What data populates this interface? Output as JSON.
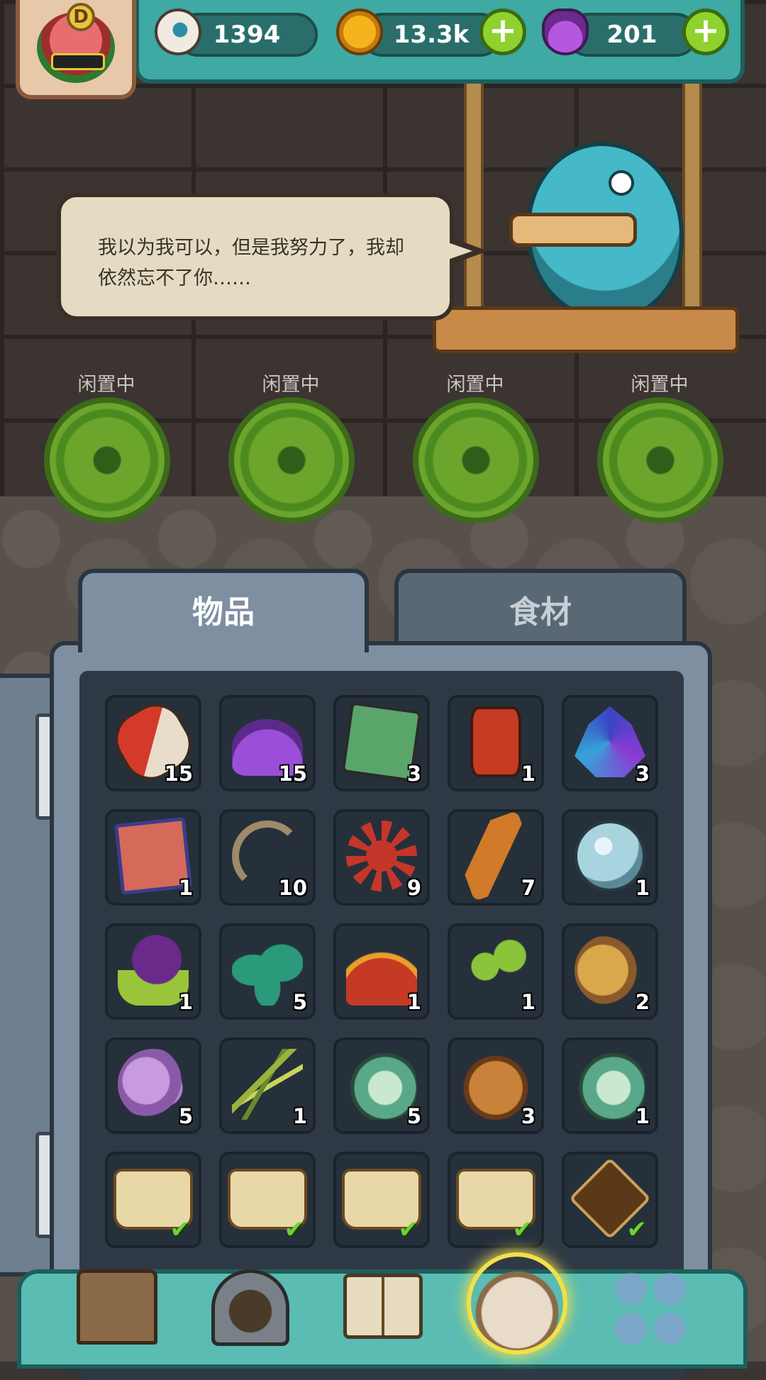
{
  "top_bar": {
    "player_level_badge": "D",
    "eyeballs": "1394",
    "coins": "13.3k",
    "potions": "201"
  },
  "dialogue": {
    "text": "我以为我可以，但是我努力了，我却依然忘不了你……"
  },
  "work_slots": [
    {
      "status": "闲置中"
    },
    {
      "status": "闲置中"
    },
    {
      "status": "闲置中"
    },
    {
      "status": "闲置中"
    }
  ],
  "inventory": {
    "tabs": [
      {
        "label": "物品",
        "active": true
      },
      {
        "label": "食材",
        "active": false
      }
    ],
    "items": [
      {
        "icon": "capsule-icon",
        "qty": "15"
      },
      {
        "icon": "purple-powder-icon",
        "qty": "15"
      },
      {
        "icon": "card-icon",
        "qty": "3"
      },
      {
        "icon": "barrel-icon",
        "qty": "1"
      },
      {
        "icon": "crystal-icon",
        "qty": "3"
      },
      {
        "icon": "map-icon",
        "qty": "1"
      },
      {
        "icon": "worm-icon",
        "qty": "10"
      },
      {
        "icon": "urchin-icon",
        "qty": "9"
      },
      {
        "icon": "feather-icon",
        "qty": "7"
      },
      {
        "icon": "orb-icon",
        "qty": "1"
      },
      {
        "icon": "skull-plant-icon",
        "qty": "1"
      },
      {
        "icon": "leaf-icon",
        "qty": "5"
      },
      {
        "icon": "red-moss-icon",
        "qty": "1"
      },
      {
        "icon": "sprout-icon",
        "qty": "1"
      },
      {
        "icon": "snail-icon",
        "qty": "2"
      },
      {
        "icon": "purple-cloud-icon",
        "qty": "5"
      },
      {
        "icon": "grass-icon",
        "qty": "1"
      },
      {
        "icon": "shell-creature-icon",
        "qty": "5"
      },
      {
        "icon": "toad-icon",
        "qty": "3"
      },
      {
        "icon": "shell-creature-icon",
        "qty": "1"
      },
      {
        "icon": "scroll-icon",
        "qty": "✔"
      },
      {
        "icon": "scroll-icon",
        "qty": "✔"
      },
      {
        "icon": "scroll-icon",
        "qty": "✔"
      },
      {
        "icon": "scroll-icon",
        "qty": "✔"
      },
      {
        "icon": "tome-icon",
        "qty": "✔"
      }
    ]
  },
  "bottom_nav": [
    {
      "icon": "shop-icon"
    },
    {
      "icon": "furnace-icon"
    },
    {
      "icon": "book-icon"
    },
    {
      "icon": "bag-icon",
      "active": true
    },
    {
      "icon": "grid-icon"
    }
  ],
  "colors": {
    "accent_teal": "#3fa9a3",
    "panel": "#7d8fa0",
    "plus_green": "#8fd12e"
  }
}
